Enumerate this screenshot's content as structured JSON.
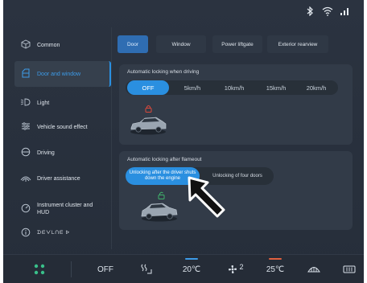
{
  "status": {
    "icons": [
      "bluetooth-icon",
      "wifi-icon",
      "signal-icon"
    ]
  },
  "sidebar": {
    "items": [
      {
        "label": "Common",
        "icon": "cube-icon"
      },
      {
        "label": "Door and window",
        "icon": "door-icon",
        "active": true
      },
      {
        "label": "Light",
        "icon": "light-icon"
      },
      {
        "label": "Vehicle sound effect",
        "icon": "sound-icon"
      },
      {
        "label": "Driving",
        "icon": "steering-wheel-icon"
      },
      {
        "label": "Driver assistance",
        "icon": "driver-assist-icon"
      },
      {
        "label": "Instrument cluster and HUD",
        "icon": "gauge-icon"
      },
      {
        "label": "ᗪᗴᐯᒪᑎᗴ ᐅ",
        "icon": "info-icon"
      }
    ]
  },
  "tabs": [
    {
      "label": "Door",
      "active": true
    },
    {
      "label": "Window"
    },
    {
      "label": "Power liftgate"
    },
    {
      "label": "Exterior rearview"
    }
  ],
  "panel_driving": {
    "title": "Automatic locking when driving",
    "options": [
      "OFF",
      "5km/h",
      "10km/h",
      "15km/h",
      "20km/h"
    ],
    "selected": "OFF"
  },
  "panel_flameout": {
    "title": "Automatic locking after flameout",
    "options": [
      "Unlocking after the driver shuts down the engine",
      "Unlocking of four doors"
    ],
    "selected": "Unlocking after the driver shuts down the engine"
  },
  "bottom": {
    "fan_state": "OFF",
    "temp_left": "20℃",
    "fan_level": "2",
    "temp_right": "25℃"
  },
  "colors": {
    "accent": "#2a8fe0",
    "lock_locked": "#d9483b",
    "lock_unlocked": "#3fb26a",
    "temp_left_indicator": "#3d9be8",
    "temp_right_indicator": "#e0603f",
    "apps_icon": "#39c08a"
  }
}
